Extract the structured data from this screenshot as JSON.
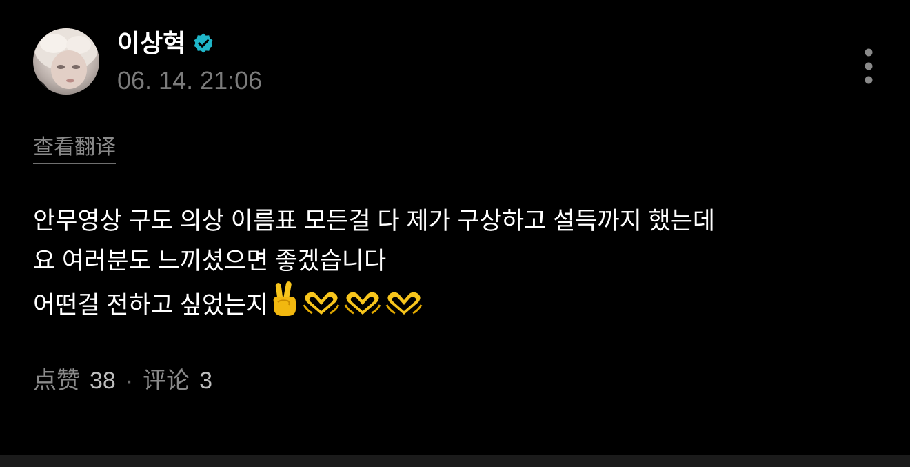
{
  "post": {
    "author": {
      "name": "이상혁",
      "verified": true
    },
    "timestamp": "06. 14. 21:06",
    "translate_label": "查看翻译",
    "lines": [
      "안무영상 구도 의상 이름표 모든걸 다 제가 구상하고 설득까지 했는데",
      "요 여러분도 느끼셨으면 좋겠습니다",
      "어떤걸 전하고 싶었는지"
    ],
    "emojis": [
      "victory-hand-emoji",
      "heart-hands-emoji",
      "heart-hands-emoji",
      "heart-hands-emoji"
    ],
    "stats": {
      "likes_label": "点赞",
      "likes_count": "38",
      "separator": "·",
      "comments_label": "评论",
      "comments_count": "3"
    }
  },
  "colors": {
    "background": "#000000",
    "verified_badge": "#1fb6c9",
    "muted_text": "#7b7b7b",
    "emoji_yellow": "#f7c51c"
  }
}
